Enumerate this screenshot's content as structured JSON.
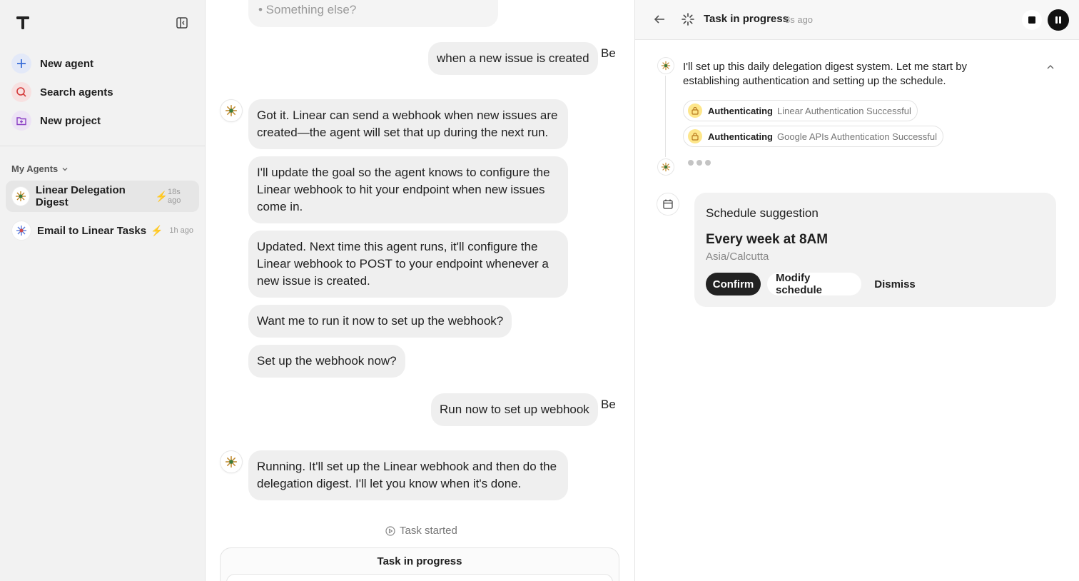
{
  "sidebar": {
    "nav": [
      {
        "label": "New agent",
        "icon": "plus-icon"
      },
      {
        "label": "Search agents",
        "icon": "search-icon"
      },
      {
        "label": "New project",
        "icon": "folder-plus-icon"
      }
    ],
    "section_label": "My Agents",
    "agents": [
      {
        "name": "Linear Delegation Digest",
        "time": "18s ago"
      },
      {
        "name": "Email to Linear Tasks",
        "time": "1h ago"
      }
    ]
  },
  "chat": {
    "faded_text": "• Something else?",
    "user_name": "Be",
    "messages": {
      "user1": "when a new issue is created",
      "bot1": "Got it. Linear can send a webhook when new issues are created—the agent will set that up during the next run.",
      "bot2": "I'll update the goal so the agent knows to configure the Linear webhook to hit your endpoint when new issues come in.",
      "bot3": "Updated. Next time this agent runs, it'll configure the Linear webhook to POST to your endpoint whenever a new issue is created.",
      "bot4": "Want me to run it now to set up the webhook?",
      "bot5": "Set up the webhook now?",
      "user2": "Run now to set up webhook",
      "bot6": "Running. It'll set up the Linear webhook and then do the delegation digest. I'll let you know when it's done."
    },
    "task_started": "Task started",
    "task_card_title": "Task in progress"
  },
  "panel": {
    "title": "Task in progress",
    "time": "8s ago",
    "message": "I'll set up this daily delegation digest system. Let me start by establishing authentication and setting up the schedule.",
    "auth": [
      {
        "label": "Authenticating",
        "detail": "Linear Authentication Successful"
      },
      {
        "label": "Authenticating",
        "detail": "Google APIs Authentication Successful"
      }
    ],
    "schedule": {
      "title": "Schedule suggestion",
      "frequency": "Every week at 8AM",
      "timezone": "Asia/Calcutta",
      "confirm": "Confirm",
      "modify": "Modify schedule",
      "dismiss": "Dismiss"
    }
  },
  "colors": {
    "accent_blue": "#3b82f6",
    "lock_yellow": "#fde68a",
    "confirm_bg": "#222222"
  }
}
